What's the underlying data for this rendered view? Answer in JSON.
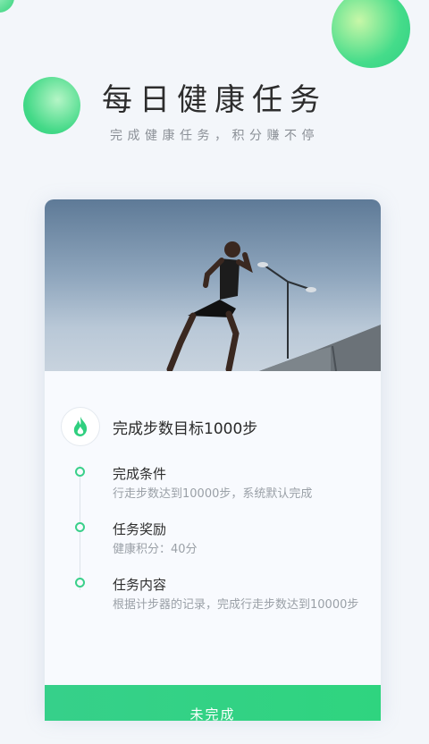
{
  "header": {
    "title": "每日健康任务",
    "subtitle": "完成健康任务，积分赚不停"
  },
  "card": {
    "photo_alt": "runner-photo",
    "task_title": "完成步数目标1000步",
    "sections": [
      {
        "label": "完成条件",
        "text": "行走步数达到10000步，系统默认完成"
      },
      {
        "label": "任务奖励",
        "text": "健康积分：40分"
      },
      {
        "label": "任务内容",
        "text": "根据计步器的记录，完成行走步数达到10000步"
      }
    ]
  },
  "cta": {
    "label": "未完成"
  },
  "colors": {
    "accent": "#36d08a",
    "flame": "#2fcf7f"
  },
  "icons": {
    "task": "flame-icon"
  }
}
